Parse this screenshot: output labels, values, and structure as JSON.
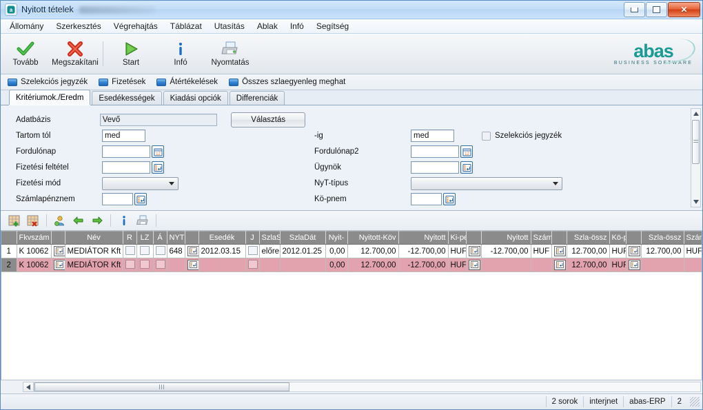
{
  "window": {
    "title": "Nyitott tételek",
    "app_icon": "abas-app-icon",
    "controls": {
      "minimize": "Minimize",
      "maximize": "Maximize",
      "close": "Close"
    }
  },
  "menu": {
    "items": [
      {
        "label": "Állomány"
      },
      {
        "label": "Szerkesztés"
      },
      {
        "label": "Végrehajtás"
      },
      {
        "label": "Táblázat"
      },
      {
        "label": "Utasítás"
      },
      {
        "label": "Ablak"
      },
      {
        "label": "Infó"
      },
      {
        "label": "Segítség"
      }
    ]
  },
  "toolbar": {
    "buttons": [
      {
        "label": "Tovább",
        "icon": "green-check-icon"
      },
      {
        "label": "Megszakítani",
        "icon": "red-x-icon"
      },
      {
        "label": "Start",
        "icon": "green-play-icon"
      },
      {
        "label": "Infó",
        "icon": "blue-info-icon"
      },
      {
        "label": "Nyomtatás",
        "icon": "printer-icon"
      }
    ],
    "logo": {
      "mark": "abas",
      "sub": "BUSINESS SOFTWARE",
      "color": "#1a9a94"
    }
  },
  "option_bar": {
    "items": [
      {
        "label": "Szelekciós jegyzék"
      },
      {
        "label": "Fizetések"
      },
      {
        "label": "Átértékelések"
      },
      {
        "label": "Összes szlaegyenleg meghat"
      }
    ]
  },
  "tabs": {
    "items": [
      {
        "label": "Kritériumok./Eredm",
        "active": true
      },
      {
        "label": "Esedékességek",
        "active": false
      },
      {
        "label": "Kiadási opciók",
        "active": false
      },
      {
        "label": "Differenciák",
        "active": false
      }
    ]
  },
  "form": {
    "left": [
      {
        "label": "Adatbázis",
        "value": "Vevő",
        "type": "readonly",
        "button": "Választás"
      },
      {
        "label": "Tartom tól",
        "value": "med",
        "type": "text"
      },
      {
        "label": "Fordulónap",
        "value": "",
        "type": "date",
        "picker": "calendar-icon"
      },
      {
        "label": "Fizetési feltétel",
        "value": "",
        "type": "lookup",
        "picker": "list-select-icon"
      },
      {
        "label": "Fizetési mód",
        "value": "",
        "type": "combo"
      },
      {
        "label": "Számlapénznem",
        "value": "",
        "type": "lookup",
        "picker": "list-select-icon"
      }
    ],
    "right": [
      {
        "label": "-ig",
        "value": "med",
        "type": "text",
        "checkbox_label": "Szelekciós jegyzék",
        "checked": false
      },
      {
        "label": "Fordulónap2",
        "value": "",
        "type": "date",
        "picker": "calendar-icon"
      },
      {
        "label": "Ügynök",
        "value": "",
        "type": "lookup",
        "picker": "list-select-icon"
      },
      {
        "label": "NyT-típus",
        "value": "",
        "type": "combo"
      },
      {
        "label": "Kö-pnem",
        "value": "",
        "type": "lookup",
        "picker": "list-select-icon"
      }
    ]
  },
  "table_toolbar": {
    "buttons": [
      {
        "icon": "add-row-icon"
      },
      {
        "icon": "delete-row-icon"
      },
      {
        "icon": "person-icon"
      },
      {
        "icon": "arrow-left-icon"
      },
      {
        "icon": "arrow-right-icon"
      },
      {
        "icon": "info-icon"
      },
      {
        "icon": "print-icon"
      }
    ]
  },
  "table": {
    "columns": [
      {
        "key": "rownum",
        "label": ""
      },
      {
        "key": "fkvszam",
        "label": "Fkvszám"
      },
      {
        "key": "pick1",
        "label": ""
      },
      {
        "key": "nev",
        "label": "Név"
      },
      {
        "key": "r",
        "label": "R"
      },
      {
        "key": "lz",
        "label": "LZ"
      },
      {
        "key": "a",
        "label": "Á"
      },
      {
        "key": "nyt",
        "label": "NYT"
      },
      {
        "key": "pick2",
        "label": ""
      },
      {
        "key": "esedek",
        "label": "Esedék"
      },
      {
        "key": "j",
        "label": "J"
      },
      {
        "key": "szlas",
        "label": "SzlaS."
      },
      {
        "key": "szladat",
        "label": "SzlaDát"
      },
      {
        "key": "nyit",
        "label": "Nyit-"
      },
      {
        "key": "nyitottkov",
        "label": "Nyitott-Köv"
      },
      {
        "key": "nyitott1",
        "label": "Nyitott"
      },
      {
        "key": "kipe",
        "label": "Ki-pé"
      },
      {
        "key": "pick3",
        "label": ""
      },
      {
        "key": "nyitott2",
        "label": "Nyitott"
      },
      {
        "key": "szam1",
        "label": "Szám"
      },
      {
        "key": "pick4",
        "label": ""
      },
      {
        "key": "szlaossz1",
        "label": "Szla-össz"
      },
      {
        "key": "kop",
        "label": "Kö-p"
      },
      {
        "key": "pick5",
        "label": ""
      },
      {
        "key": "szlaossz2",
        "label": "Szla-össz"
      },
      {
        "key": "szam2",
        "label": "Szám"
      },
      {
        "key": "pick6",
        "label": ""
      }
    ],
    "rows": [
      {
        "rownum": "1",
        "fkvszam": "K 10062",
        "nev": "MEDIÁTOR Kft",
        "r": "",
        "lz": "",
        "a": "",
        "nyt": "648",
        "esedek": "2012.03.15",
        "j": "",
        "szlas": "előre",
        "szladat": "2012.01.25",
        "nyit": "0,00",
        "nyitottkov": "12.700,00",
        "nyitott1": "-12.700,00",
        "kipe": "HUF",
        "nyitott2": "-12.700,00",
        "szam1": "HUF",
        "szlaossz1": "12.700,00",
        "kop": "HUF",
        "szlaossz2": "12.700,00",
        "szam2": "HUF",
        "selected": false
      },
      {
        "rownum": "2",
        "fkvszam": "K 10062",
        "nev": "MEDIÁTOR Kft",
        "r": "",
        "lz": "",
        "a": "",
        "nyt": "",
        "esedek": "",
        "j": "",
        "szlas": "",
        "szladat": "",
        "nyit": "0,00",
        "nyitottkov": "12.700,00",
        "nyitott1": "-12.700,00",
        "kipe": "HUF",
        "nyitott2": "",
        "szam1": "",
        "szlaossz1": "12.700,00",
        "kop": "HUF",
        "szlaossz2": "",
        "szam2": "",
        "selected": true
      }
    ]
  },
  "status_bar": {
    "rows_count": "2 sorok",
    "user": "interjnet",
    "system": "abas-ERP",
    "number": "2"
  },
  "colors": {
    "accent": "#1a9a94",
    "selected_row": "#e2a3ae",
    "header_gray": "#8b8b8b",
    "negative": "#e02020",
    "close_button": "#d23f15"
  }
}
